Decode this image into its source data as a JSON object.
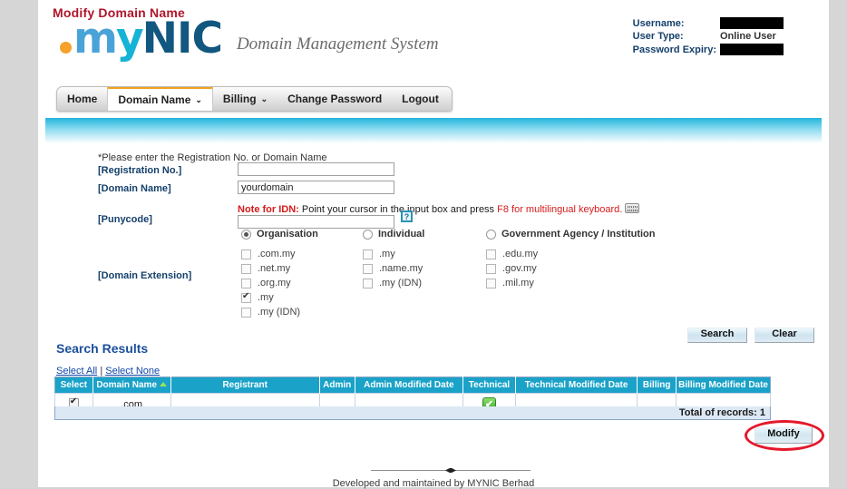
{
  "brand": {
    "logo_dot": "dot",
    "logo_my": "my",
    "logo_m": "m",
    "logo_y": "y",
    "logo_nic": "NIC",
    "tagline": "Domain Management System"
  },
  "userinfo": {
    "username_label": "Username:",
    "username_value": "",
    "usertype_label": "User Type:",
    "usertype_value": "Online User",
    "password_expiry_label": "Password Expiry:",
    "password_expiry_value": ""
  },
  "nav": {
    "tabs": [
      {
        "label": "Home",
        "caret": "",
        "active": false
      },
      {
        "label": "Domain Name",
        "caret": "⌄",
        "active": true
      },
      {
        "label": "Billing",
        "caret": "⌄",
        "active": false
      },
      {
        "label": "Change Password",
        "caret": "",
        "active": false
      },
      {
        "label": "Logout",
        "caret": "",
        "active": false
      }
    ]
  },
  "banner": {
    "title": "Modify Domain Name"
  },
  "form": {
    "hint": "*Please enter the Registration No. or Domain Name",
    "registration_label": "[Registration No.]",
    "registration_value": "",
    "domain_label": "[Domain Name]",
    "domain_value": "yourdomain",
    "punycode_label": "[Punycode]",
    "punycode_value": "",
    "help_icon": "?",
    "idn_note_bold": "Note for IDN:",
    "idn_note_text": " Point your cursor in the input box and press ",
    "idn_note_red": "F8 for multilingual keyboard.",
    "entity_types": [
      {
        "label": "Organisation",
        "selected": true
      },
      {
        "label": "Individual",
        "selected": false
      },
      {
        "label": "Government Agency / Institution",
        "selected": false
      }
    ],
    "extension_label": "[Domain Extension]",
    "extension_columns": [
      [
        {
          "label": ".com.my",
          "checked": false
        },
        {
          "label": ".net.my",
          "checked": false
        },
        {
          "label": ".org.my",
          "checked": false
        },
        {
          "label": ".my",
          "checked": true
        },
        {
          "label": ".my (IDN)",
          "checked": false
        }
      ],
      [
        {
          "label": ".my",
          "checked": false
        },
        {
          "label": ".name.my",
          "checked": false
        },
        {
          "label": ".my (IDN)",
          "checked": false
        }
      ],
      [
        {
          "label": ".edu.my",
          "checked": false
        },
        {
          "label": ".gov.my",
          "checked": false
        },
        {
          "label": ".mil.my",
          "checked": false
        }
      ]
    ],
    "search_label": "Search",
    "clear_label": "Clear"
  },
  "results": {
    "title": "Search Results",
    "select_all": "Select All",
    "separator": "|",
    "select_none": "Select None",
    "columns": [
      "Select",
      "Domain Name",
      "Registrant",
      "Admin",
      "Admin Modified Date",
      "Technical",
      "Technical Modified Date",
      "Billing",
      "Billing Modified Date"
    ],
    "sorted_column": "Domain Name",
    "rows": [
      {
        "selected": true,
        "domain_name": ".com",
        "registrant": "",
        "admin": "",
        "admin_modified_date": "",
        "technical": "✔",
        "technical_modified_date": "",
        "billing": "",
        "billing_modified_date": ""
      }
    ],
    "total_text": "Total of records: 1",
    "modify_label": "Modify"
  },
  "footer": {
    "text": "Developed and maintained by MYNIC Berhad"
  },
  "colors": {
    "banner_cyan": "#21b6dd",
    "heading_red": "#b1152a",
    "table_header": "#1aa2c8",
    "link_blue": "#1146a8",
    "annotation_red": "#e4192b",
    "active_tab_orange": "#f0a31e",
    "logo_orange": "#f5a12b",
    "logo_navy": "#12577f"
  }
}
